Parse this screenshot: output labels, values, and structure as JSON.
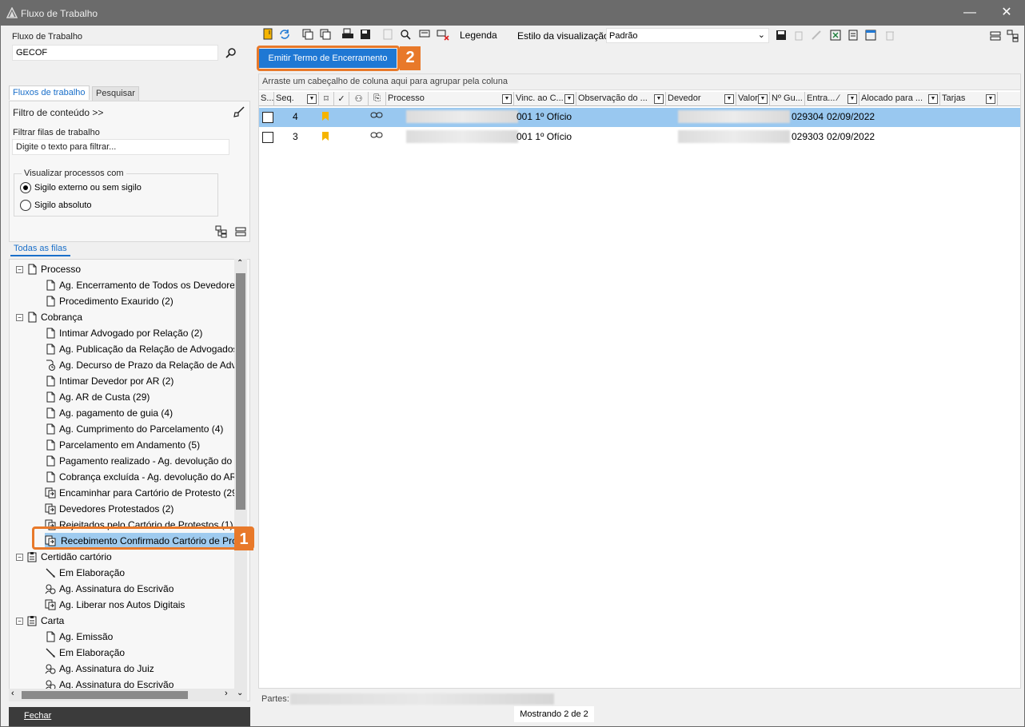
{
  "window": {
    "title": "Fluxo de Trabalho",
    "minimize_glyph": "—",
    "close_glyph": "✕"
  },
  "left": {
    "workflow_label": "Fluxo de Trabalho",
    "workflow_value": "GECOF",
    "tabs": [
      "Fluxos de trabalho",
      "Pesquisar"
    ],
    "content_filter_label": "Filtro de conteúdo >>",
    "filter_queues_label": "Filtrar filas de trabalho",
    "filter_queues_placeholder": "Digite o texto para filtrar...",
    "visualize_label": "Visualizar processos com",
    "radio_options": [
      {
        "label": "Sigilo externo ou sem sigilo",
        "checked": true
      },
      {
        "label": "Sigilo absoluto",
        "checked": false
      }
    ],
    "all_queues_label": "Todas as filas",
    "tree": [
      {
        "label": "Processo",
        "level": 0,
        "icon": "doc-icon"
      },
      {
        "label": "Ag. Encerramento de Todos os Devedores",
        "level": 1,
        "icon": "doc-icon"
      },
      {
        "label": "Procedimento Exaurido (2)",
        "level": 1,
        "icon": "doc-icon"
      },
      {
        "label": "Cobrança",
        "level": 0,
        "icon": "doc-icon"
      },
      {
        "label": "Intimar Advogado por Relação (2)",
        "level": 1,
        "icon": "doc-icon"
      },
      {
        "label": "Ag. Publicação da Relação de Advogados",
        "level": 1,
        "icon": "doc-icon"
      },
      {
        "label": "Ag. Decurso de Prazo da Relação de Advc",
        "level": 1,
        "icon": "clock-doc-icon"
      },
      {
        "label": "Intimar Devedor por AR (2)",
        "level": 1,
        "icon": "doc-icon"
      },
      {
        "label": "Ag. AR de Custa (29)",
        "level": 1,
        "icon": "doc-icon"
      },
      {
        "label": "Ag. pagamento de guia (4)",
        "level": 1,
        "icon": "doc-icon"
      },
      {
        "label": "Ag. Cumprimento do Parcelamento (4)",
        "level": 1,
        "icon": "doc-icon"
      },
      {
        "label": "Parcelamento em Andamento (5)",
        "level": 1,
        "icon": "doc-icon"
      },
      {
        "label": "Pagamento realizado - Ag. devolução do",
        "level": 1,
        "icon": "doc-icon"
      },
      {
        "label": "Cobrança excluída - Ag. devolução do AR",
        "level": 1,
        "icon": "doc-icon"
      },
      {
        "label": "Encaminhar para Cartório de Protesto (29",
        "level": 1,
        "icon": "transfer-icon"
      },
      {
        "label": "Devedores Protestados (2)",
        "level": 1,
        "icon": "transfer-icon"
      },
      {
        "label": "Rejeitados pelo Cartório de Protestos (1)",
        "level": 1,
        "icon": "transfer-icon"
      },
      {
        "label": "Recebimento Confirmado Cartório de Prot",
        "level": 1,
        "icon": "transfer-icon",
        "selected": true
      },
      {
        "label": "Certidão cartório",
        "level": 0,
        "icon": "clipboard-icon"
      },
      {
        "label": "Em Elaboração",
        "level": 1,
        "icon": "pen-icon"
      },
      {
        "label": "Ag. Assinatura do Escrivão",
        "level": 1,
        "icon": "signature-icon"
      },
      {
        "label": "Ag. Liberar nos Autos Digitais",
        "level": 1,
        "icon": "transfer-icon"
      },
      {
        "label": "Carta",
        "level": 0,
        "icon": "clipboard-icon"
      },
      {
        "label": "Ag. Emissão",
        "level": 1,
        "icon": "doc-icon"
      },
      {
        "label": "Em Elaboração",
        "level": 1,
        "icon": "pen-icon"
      },
      {
        "label": "Ag. Assinatura do Juiz",
        "level": 1,
        "icon": "signature-icon"
      },
      {
        "label": "Ag. Assinatura do Escrivão",
        "level": 1,
        "icon": "signature-icon"
      }
    ],
    "close_button": "Fechar",
    "callout_1": "1"
  },
  "toolbar": {
    "legend_label": "Legenda",
    "view_style_label": "Estilo da visualização",
    "view_style_value": "Padrão",
    "emit_button": "Emitir Termo de Encerramento",
    "callout_2": "2"
  },
  "grid": {
    "group_hint": "Arraste um cabeçalho de coluna aqui para agrupar pela coluna",
    "columns": [
      "S...",
      "Seq.",
      "",
      "",
      "",
      "",
      "Processo",
      "Vinc. ao C...",
      "Observação do ...",
      "Devedor",
      "Valor ...",
      "Nº Gu...",
      "Entra... ∕",
      "Alocado para ...",
      "Tarjas"
    ],
    "rows": [
      {
        "seq": "4",
        "vinc": "001 1º Ofício",
        "guia": "029304",
        "entrada": "02/09/2022"
      },
      {
        "seq": "3",
        "vinc": "001 1º Ofício",
        "guia": "029303",
        "entrada": "02/09/2022"
      }
    ],
    "partes_label": "Partes:",
    "status": "Mostrando 2 de 2"
  }
}
